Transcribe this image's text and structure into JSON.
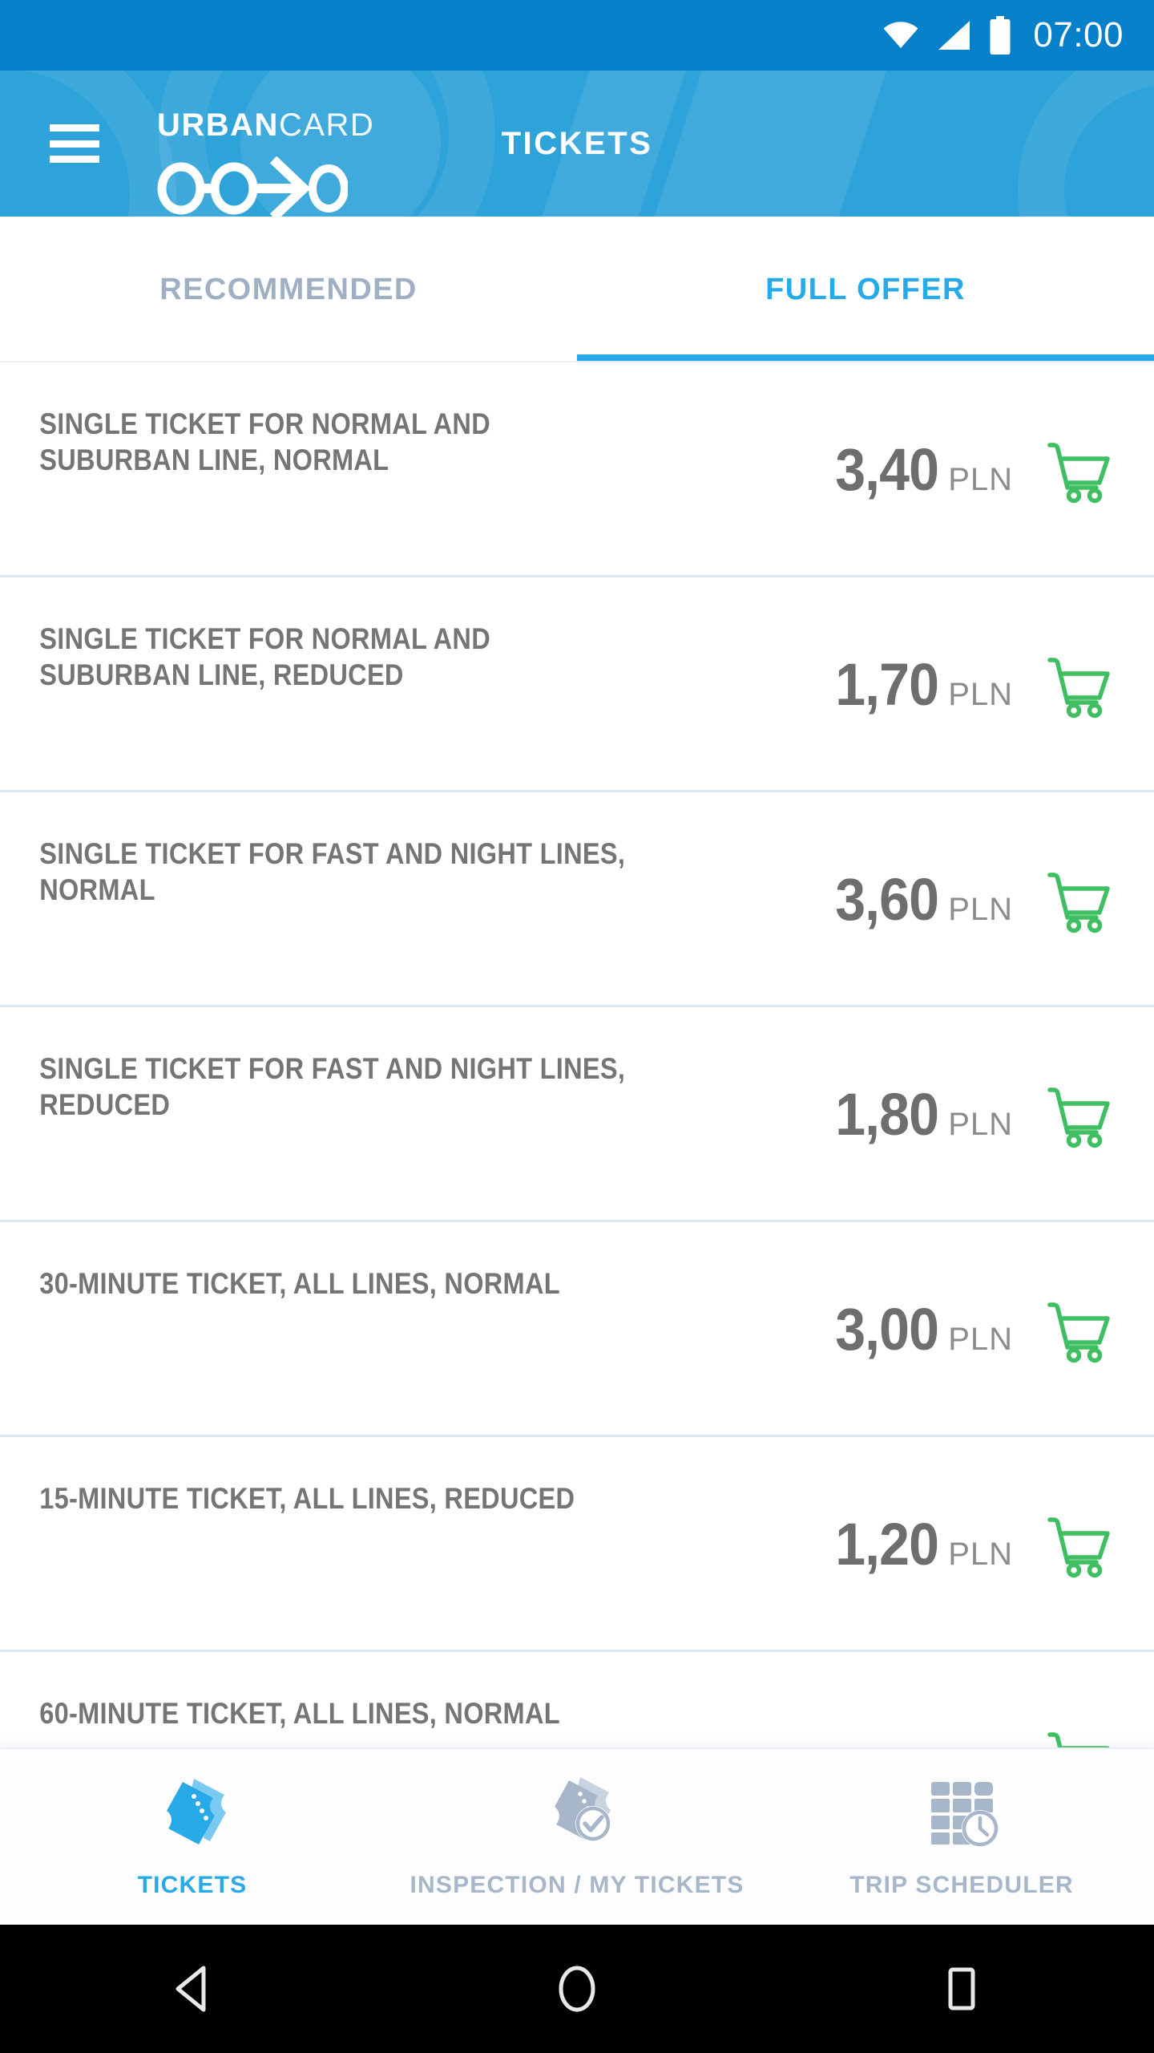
{
  "status_bar": {
    "time": "07:00",
    "icons": [
      "wifi-icon",
      "cellular-signal-icon",
      "battery-icon"
    ],
    "background_color": "#0680C8"
  },
  "header": {
    "menu_icon": "hamburger-menu-icon",
    "brand_bold": "URBAN",
    "brand_light": "CARD",
    "logo_icon": "urbancard-transit-logo",
    "title": "TICKETS",
    "background_color": "#2EA3DA"
  },
  "tabs": {
    "items": [
      {
        "label": "RECOMMENDED",
        "active": false
      },
      {
        "label": "FULL OFFER",
        "active": true
      }
    ],
    "active_color": "#27AAE9",
    "inactive_color": "#9FB0C4"
  },
  "ticket_list": {
    "currency": "PLN",
    "cart_icon": "shopping-cart-icon",
    "cart_color": "#3FBF62",
    "rows": [
      {
        "title": "SINGLE TICKET FOR NORMAL AND SUBURBAN LINE, NORMAL",
        "price": "3,40",
        "currency": "PLN"
      },
      {
        "title": "SINGLE TICKET FOR NORMAL AND SUBURBAN LINE, REDUCED",
        "price": "1,70",
        "currency": "PLN"
      },
      {
        "title": "SINGLE TICKET FOR FAST AND NIGHT LINES, NORMAL",
        "price": "3,60",
        "currency": "PLN"
      },
      {
        "title": "SINGLE TICKET FOR FAST AND NIGHT LINES, REDUCED",
        "price": "1,80",
        "currency": "PLN"
      },
      {
        "title": "30-MINUTE TICKET, ALL LINES, NORMAL",
        "price": "3,00",
        "currency": "PLN"
      },
      {
        "title": "15-MINUTE TICKET, ALL LINES, REDUCED",
        "price": "1,20",
        "currency": "PLN"
      },
      {
        "title": "60-MINUTE TICKET, ALL LINES, NORMAL",
        "price": "",
        "currency": ""
      }
    ]
  },
  "bottom_nav": {
    "items": [
      {
        "label": "TICKETS",
        "icon": "tickets-icon",
        "active": true
      },
      {
        "label": "INSPECTION / MY TICKETS",
        "icon": "ticket-check-icon",
        "active": false
      },
      {
        "label": "TRIP SCHEDULER",
        "icon": "timetable-clock-icon",
        "active": false
      }
    ],
    "active_color": "#29AAE8",
    "inactive_color": "#A7B6C9"
  },
  "android_nav": {
    "buttons": [
      {
        "name": "back-button",
        "icon": "back-triangle-icon"
      },
      {
        "name": "home-button",
        "icon": "home-circle-icon"
      },
      {
        "name": "recents-button",
        "icon": "recents-square-icon"
      }
    ]
  }
}
